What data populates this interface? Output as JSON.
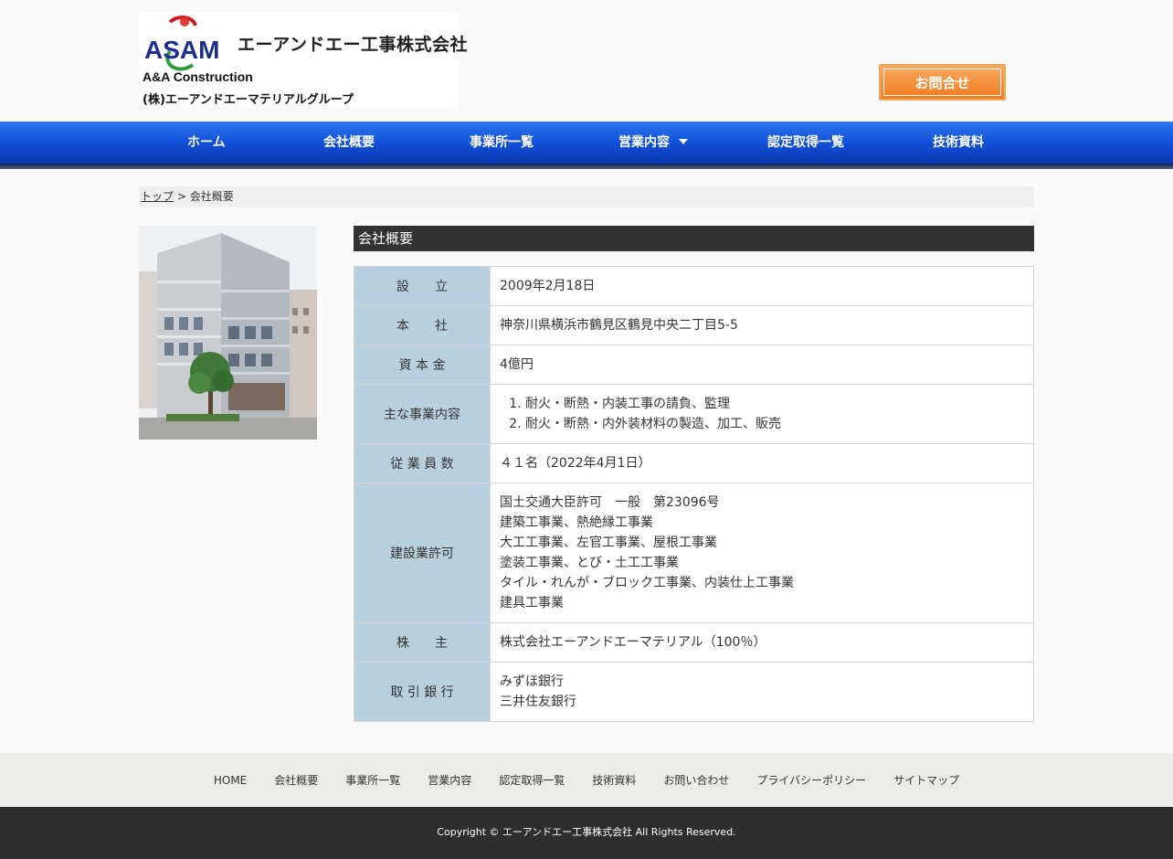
{
  "header": {
    "company_name": "エーアンドエー工事株式会社",
    "logo_letters": "ASAM",
    "company_name_en": "A&A Construction",
    "group_name": "(株)エーアンドエーマテリアルグループ",
    "contact_label": "お問合せ"
  },
  "nav": {
    "items": [
      {
        "label": "ホーム"
      },
      {
        "label": "会社概要"
      },
      {
        "label": "事業所一覧"
      },
      {
        "label": "営業内容"
      },
      {
        "label": "認定取得一覧"
      },
      {
        "label": "技術資料"
      }
    ]
  },
  "breadcrumb": {
    "top_link": "トップ",
    "separator": " > ",
    "current": "会社概要"
  },
  "main": {
    "title": "会社概要",
    "rows": [
      {
        "label": "設　　立",
        "lines": [
          "2009年2月18日"
        ]
      },
      {
        "label": "本　　社",
        "lines": [
          "神奈川県横浜市鶴見区鶴見中央二丁目5-5"
        ]
      },
      {
        "label": "資 本 金",
        "lines": [
          "4億円"
        ]
      },
      {
        "label": "主な事業内容",
        "ordered": [
          "耐火・断熱・内装工事の請負、監理",
          "耐火・断熱・内外装材料の製造、加工、販売"
        ]
      },
      {
        "label": "従 業 員 数",
        "lines": [
          "４１名（2022年4月1日）"
        ]
      },
      {
        "label": "建設業許可",
        "lines": [
          "国土交通大臣許可　一般　第23096号",
          "建築工事業、熱絶縁工事業",
          "大工工事業、左官工事業、屋根工事業",
          "塗装工事業、とび・土工工事業",
          "タイル・れんが・ブロック工事業、内装仕上工事業",
          "建具工事業"
        ]
      },
      {
        "label": "株　　主",
        "lines": [
          "株式会社エーアンドエーマテリアル（100％）"
        ]
      },
      {
        "label": "取 引 銀 行",
        "lines": [
          "みずほ銀行",
          "三井住友銀行"
        ]
      }
    ]
  },
  "footer": {
    "links": [
      "HOME",
      "会社概要",
      "事業所一覧",
      "営業内容",
      "認定取得一覧",
      "技術資料",
      "お問い合わせ",
      "プライバシーポリシー",
      "サイトマップ"
    ],
    "copyright": "Copyright © エーアンドエー工事株式会社 All Rights Reserved."
  },
  "colors": {
    "nav_blue": "#1150d8",
    "contact_orange": "#f07d1f",
    "table_header": "#b8d0de",
    "section_title_bg": "#333333",
    "footer_dark": "#2e2e2e"
  }
}
